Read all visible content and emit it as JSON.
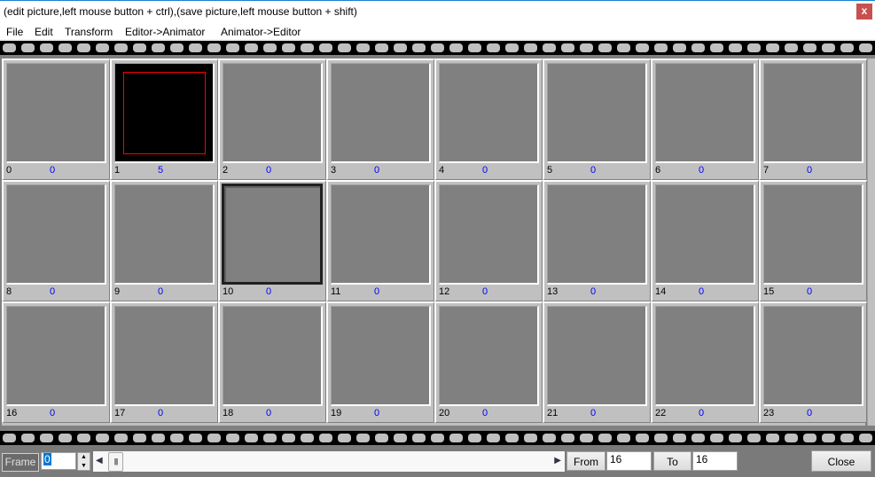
{
  "window": {
    "title": "(edit picture,left mouse button + ctrl),(save picture,left mouse button + shift)",
    "close_label": "x"
  },
  "menu": {
    "items": [
      "File",
      "Edit",
      "Transform",
      "Editor->Animator",
      "Animator->Editor"
    ]
  },
  "frames": [
    {
      "index": "0",
      "value": "0"
    },
    {
      "index": "1",
      "value": "5",
      "content": "black-with-red-rectangle"
    },
    {
      "index": "2",
      "value": "0"
    },
    {
      "index": "3",
      "value": "0"
    },
    {
      "index": "4",
      "value": "0"
    },
    {
      "index": "5",
      "value": "0"
    },
    {
      "index": "6",
      "value": "0"
    },
    {
      "index": "7",
      "value": "0"
    },
    {
      "index": "8",
      "value": "0"
    },
    {
      "index": "9",
      "value": "0"
    },
    {
      "index": "10",
      "value": "0",
      "selected": true
    },
    {
      "index": "11",
      "value": "0"
    },
    {
      "index": "12",
      "value": "0"
    },
    {
      "index": "13",
      "value": "0"
    },
    {
      "index": "14",
      "value": "0"
    },
    {
      "index": "15",
      "value": "0"
    },
    {
      "index": "16",
      "value": "0"
    },
    {
      "index": "17",
      "value": "0"
    },
    {
      "index": "18",
      "value": "0"
    },
    {
      "index": "19",
      "value": "0"
    },
    {
      "index": "20",
      "value": "0"
    },
    {
      "index": "21",
      "value": "0"
    },
    {
      "index": "22",
      "value": "0"
    },
    {
      "index": "23",
      "value": "0"
    }
  ],
  "bottom": {
    "frame_label": "Frame",
    "frame_value": "0",
    "spin_up": "▲",
    "spin_down": "▼",
    "scroll_left": "◀",
    "scroll_right": "▶",
    "scroll_grip": "||||",
    "from_label": "From",
    "from_value": "16",
    "to_label": "To",
    "to_value": "16",
    "close_label": "Close"
  },
  "colors": {
    "frame_value_text": "#0000ff",
    "thumbnail_red_border": "#ff0000",
    "window_close_bg": "#c75050"
  }
}
